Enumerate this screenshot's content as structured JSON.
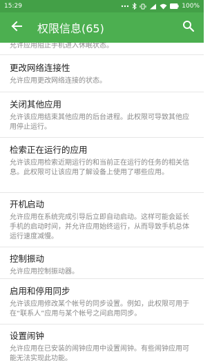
{
  "status_bar": {
    "time": "15:29",
    "battery": "100%"
  },
  "app_bar": {
    "title": "权限信息(65)",
    "back_icon": "arrow-back-icon",
    "search_icon": "search-icon",
    "color": "#4caf50"
  },
  "permissions": [
    {
      "title": "",
      "desc": "允许应用阻止手机进入休眠状态。"
    },
    {
      "title": "更改网络连接性",
      "desc": "允许应用更改网络连接的状态。"
    },
    {
      "title": "关闭其他应用",
      "desc": "允许该应用结束其他应用的后台进程。此权限可导致其他应用停止运行。"
    },
    {
      "title": "检索正在运行的应用",
      "desc": "允许该应用检索近期运行的和当前正在运行的任务的相关信息。此权限可让该应用了解设备上使用了哪些应用。"
    },
    {
      "title": "开机启动",
      "desc": "允许应用在系统完成引导后立即自动启动。这样可能会延长手机的启动时间，并允许应用始终运行，从而导致手机总体运行速度减慢。"
    },
    {
      "title": "控制振动",
      "desc": "允许应用控制振动器。"
    },
    {
      "title": "启用和停用同步",
      "desc": "允许该应用修改某个帐号的同步设置。例如，此权限可用于在“联系人”应用与某个帐号之间启用同步。"
    },
    {
      "title": "设置闹钟",
      "desc": "允许应用在已安装的闹钟应用中设置闹钟。有些闹钟应用可能无法实现此功能。"
    }
  ]
}
